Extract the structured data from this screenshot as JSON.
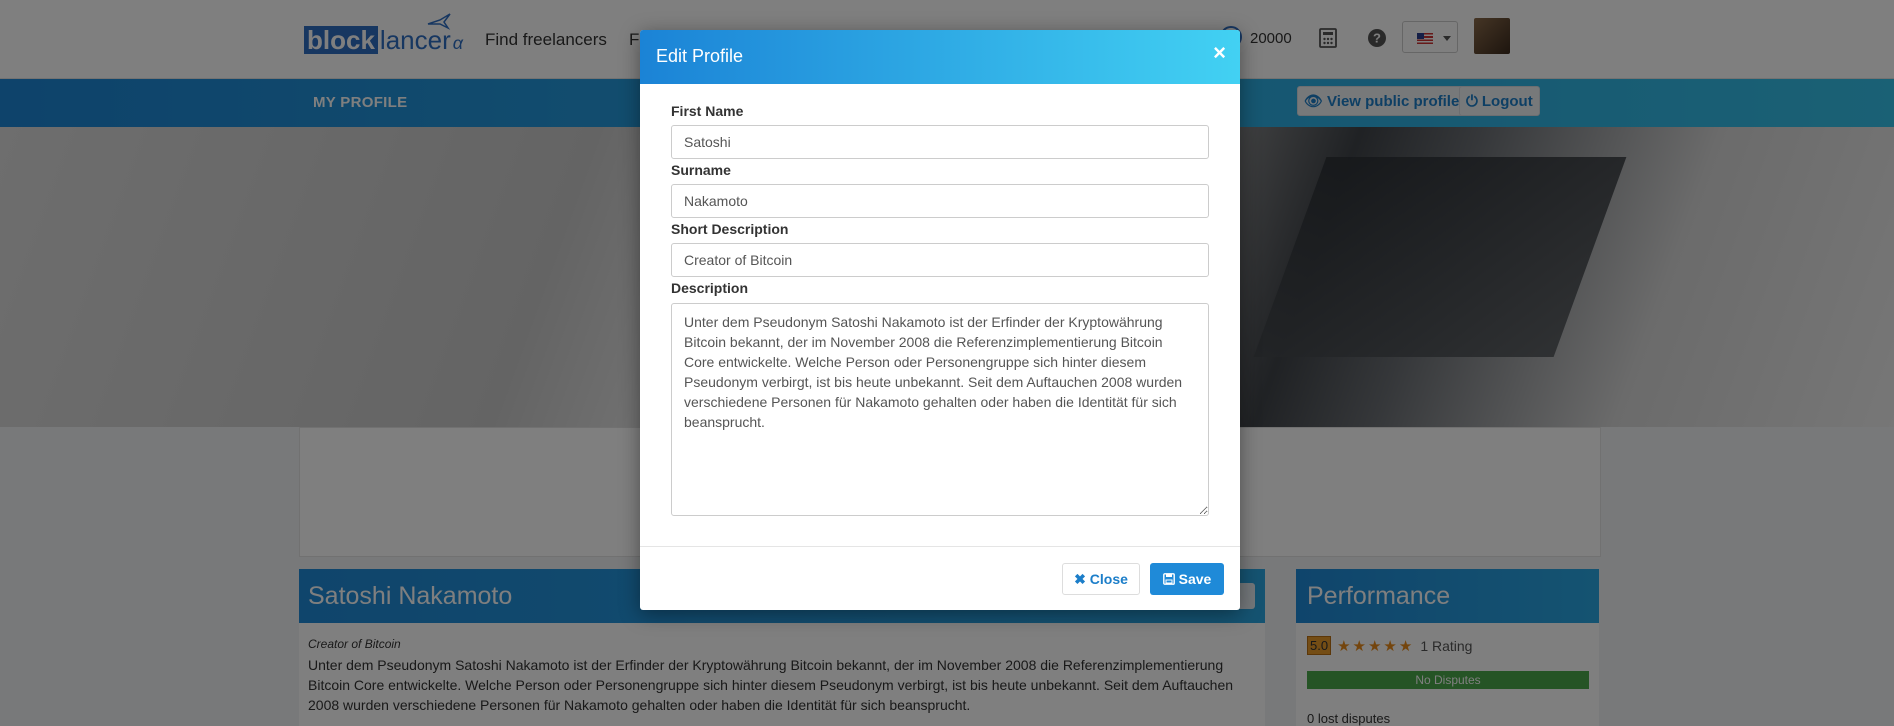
{
  "nav": {
    "logo_block": "block",
    "logo_lancer": "lancer",
    "logo_alpha": "α",
    "find_freelancers": "Find freelancers",
    "find_truncated": "F",
    "balance": "20000"
  },
  "subnav": {
    "my_profile": "MY PROFILE",
    "view_public_profile": "View public profile",
    "logout": "Logout"
  },
  "profile": {
    "name": "Satoshi Nakamoto",
    "short_description": "Creator of Bitcoin",
    "description": "Unter dem Pseudonym Satoshi Nakamoto ist der Erfinder der Kryptowährung Bitcoin bekannt, der im November 2008 die Referenzimplementierung Bitcoin Core entwickelte. Welche Person oder Personengruppe sich hinter diesem Pseudonym verbirgt, ist bis heute unbekannt. Seit dem Auftauchen 2008 wurden verschiedene Personen für Nakamoto gehalten oder haben die Identität für sich beansprucht."
  },
  "performance": {
    "title": "Performance",
    "rating": "5.0",
    "rating_count": "1 Rating",
    "disputes": "No Disputes",
    "lost_disputes": "0 lost disputes"
  },
  "modal": {
    "title": "Edit Profile",
    "close_x": "×",
    "first_name_label": "First Name",
    "first_name_value": "Satoshi",
    "surname_label": "Surname",
    "surname_value": "Nakamoto",
    "short_description_label": "Short Description",
    "short_description_value": "Creator of Bitcoin",
    "description_label": "Description",
    "description_value": "Unter dem Pseudonym Satoshi Nakamoto ist der Erfinder der Kryptowährung Bitcoin bekannt, der im November 2008 die Referenzimplementierung Bitcoin Core entwickelte. Welche Person oder Personengruppe sich hinter diesem Pseudonym verbirgt, ist bis heute unbekannt. Seit dem Auftauchen 2008 wurden verschiedene Personen für Nakamoto gehalten oder haben die Identität für sich beansprucht.",
    "close_button": "Close",
    "save_button": "Save"
  },
  "colors": {
    "brand_blue": "#1c86d6",
    "accent_cyan": "#42d1f3",
    "disputes_green": "#4aa84a",
    "rating_orange": "#e88a1a"
  }
}
